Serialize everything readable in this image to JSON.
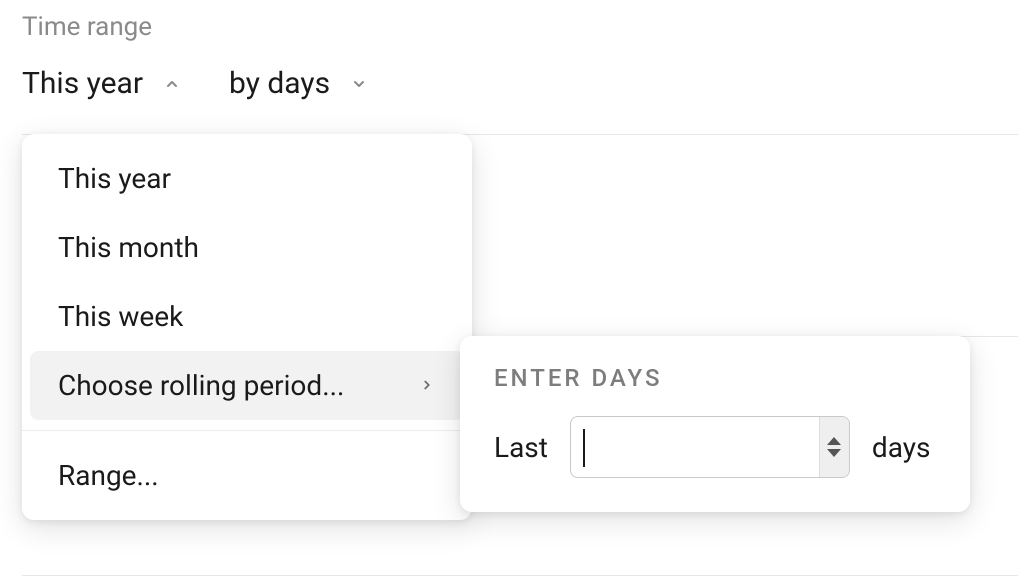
{
  "section_label": "Time range",
  "selectors": {
    "range": {
      "label": "This year",
      "open": true
    },
    "granularity": {
      "label": "by days",
      "open": false
    }
  },
  "dropdown": {
    "items": [
      {
        "label": "This year"
      },
      {
        "label": "This month"
      },
      {
        "label": "This week"
      },
      {
        "label": "Choose rolling period...",
        "has_submenu": true,
        "hovered": true
      }
    ],
    "footer": {
      "label": "Range..."
    }
  },
  "submenu": {
    "title": "ENTER DAYS",
    "prefix": "Last",
    "suffix": "days",
    "value": ""
  }
}
